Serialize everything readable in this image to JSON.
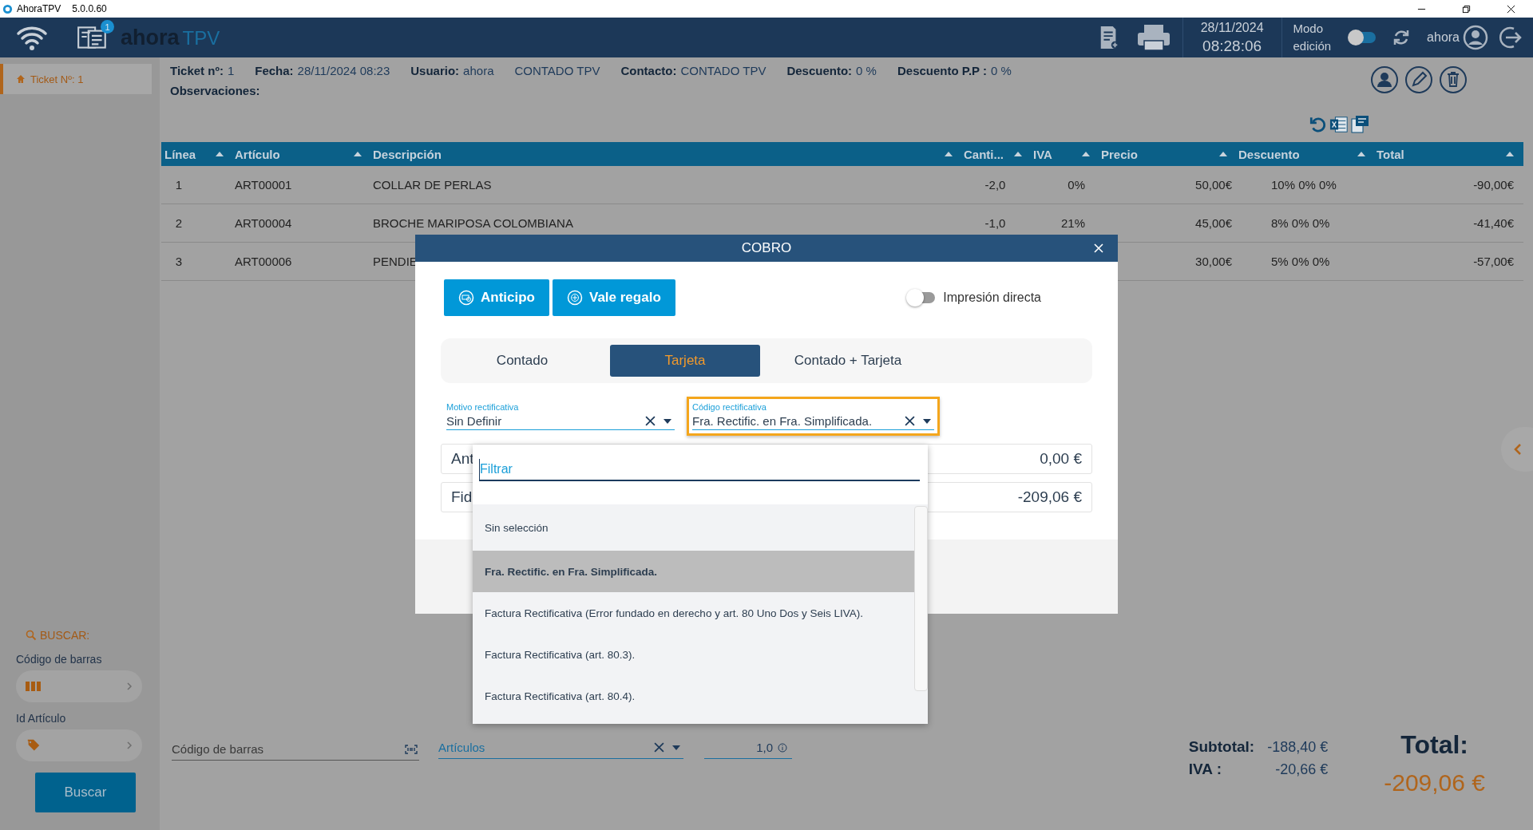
{
  "title_bar": {
    "app": "AhoraTPV",
    "version": "5.0.0.60"
  },
  "header": {
    "badge": "1",
    "logo_first": "ahora",
    "logo_second": "TPV",
    "date": "28/11/2024",
    "time": "08:28:06",
    "mode_line1": "Modo",
    "mode_line2": "edición",
    "mode_toggle": {
      "on": false
    },
    "user": "ahora"
  },
  "sidebar": {
    "tabs": [
      {
        "label": "Ticket Nº: 1",
        "selected": true
      }
    ],
    "search_title": "BUSCAR:",
    "search_fields": [
      {
        "label": "Código de barras",
        "kind": "barcode"
      },
      {
        "label": "Id Artículo",
        "kind": "tag"
      }
    ],
    "search_button": "Buscar"
  },
  "ticket_info": [
    {
      "label": "Ticket nº:",
      "value": "1"
    },
    {
      "label": "Fecha:",
      "value": "28/11/2024 08:23"
    },
    {
      "label": "Usuario:",
      "value": "ahora"
    },
    {
      "value": "CONTADO TPV"
    },
    {
      "label": "Contacto:",
      "value": "CONTADO TPV"
    },
    {
      "label": "Descuento:",
      "value": "0 %"
    },
    {
      "label": "Descuento P.P :",
      "value": "0 %"
    }
  ],
  "observations_label": "Observaciones:",
  "table": {
    "columns": [
      "Línea",
      "Artículo",
      "Descripción",
      "Canti...",
      "IVA",
      "Precio",
      "Descuento",
      "Total"
    ],
    "rows": [
      {
        "line": "1",
        "article": "ART00001",
        "description": "COLLAR DE PERLAS",
        "quantity": "-2,0",
        "vat": "0%",
        "price": "50,00€",
        "discount": "10% 0% 0%",
        "total": "-90,00€"
      },
      {
        "line": "2",
        "article": "ART00004",
        "description": "BROCHE MARIPOSA COLOMBIANA",
        "quantity": "-1,0",
        "vat": "21%",
        "price": "45,00€",
        "discount": "8% 0% 0%",
        "total": "-41,40€"
      },
      {
        "line": "3",
        "article": "ART00006",
        "description": "PENDIE",
        "price": "30,00€",
        "discount": "5% 0% 0%",
        "total": "-57,00€"
      }
    ]
  },
  "bottom_bar": {
    "barcode_placeholder": "Código de barras",
    "articles_placeholder": "Artículos",
    "quantity": "1,0"
  },
  "totals": {
    "subtotal_label": "Subtotal:",
    "subtotal": "-188,40 €",
    "vat_label": "IVA :",
    "vat": "-20,66 €",
    "total_label": "Total:",
    "total": "-209,06 €"
  },
  "modal": {
    "title": "COBRO",
    "buttons": [
      {
        "label": "Anticipo",
        "kind": "advance"
      },
      {
        "label": "Vale regalo",
        "kind": "gift"
      }
    ],
    "direct_print": {
      "label": "Impresión directa",
      "on": false
    },
    "payment_tabs": [
      {
        "label": "Contado",
        "selected": false
      },
      {
        "label": "Tarjeta",
        "selected": true
      },
      {
        "label": "Contado + Tarjeta",
        "selected": false
      }
    ],
    "fields": [
      {
        "label": "Motivo rectificativa",
        "value": "Sin Definir",
        "focused": false
      },
      {
        "label": "Código rectificativa",
        "value": "Fra. Rectific. en Fra. Simplificada.",
        "focused": true
      }
    ],
    "amounts": [
      {
        "label": "Ant",
        "value": "0,00 €"
      },
      {
        "label": "Fid",
        "value": "-209,06 €"
      }
    ]
  },
  "dropdown": {
    "filter_placeholder": "Filtrar",
    "options": [
      {
        "label": "Sin selección",
        "selected": false
      },
      {
        "label": "Fra. Rectific. en Fra. Simplificada.",
        "selected": true
      },
      {
        "label": "Factura Rectificativa (Error fundado en derecho y art. 80 Uno Dos y Seis LIVA).",
        "selected": false
      },
      {
        "label": "Factura Rectificativa (art. 80.3).",
        "selected": false
      },
      {
        "label": "Factura Rectificativa (art. 80.4).",
        "selected": false
      }
    ]
  }
}
